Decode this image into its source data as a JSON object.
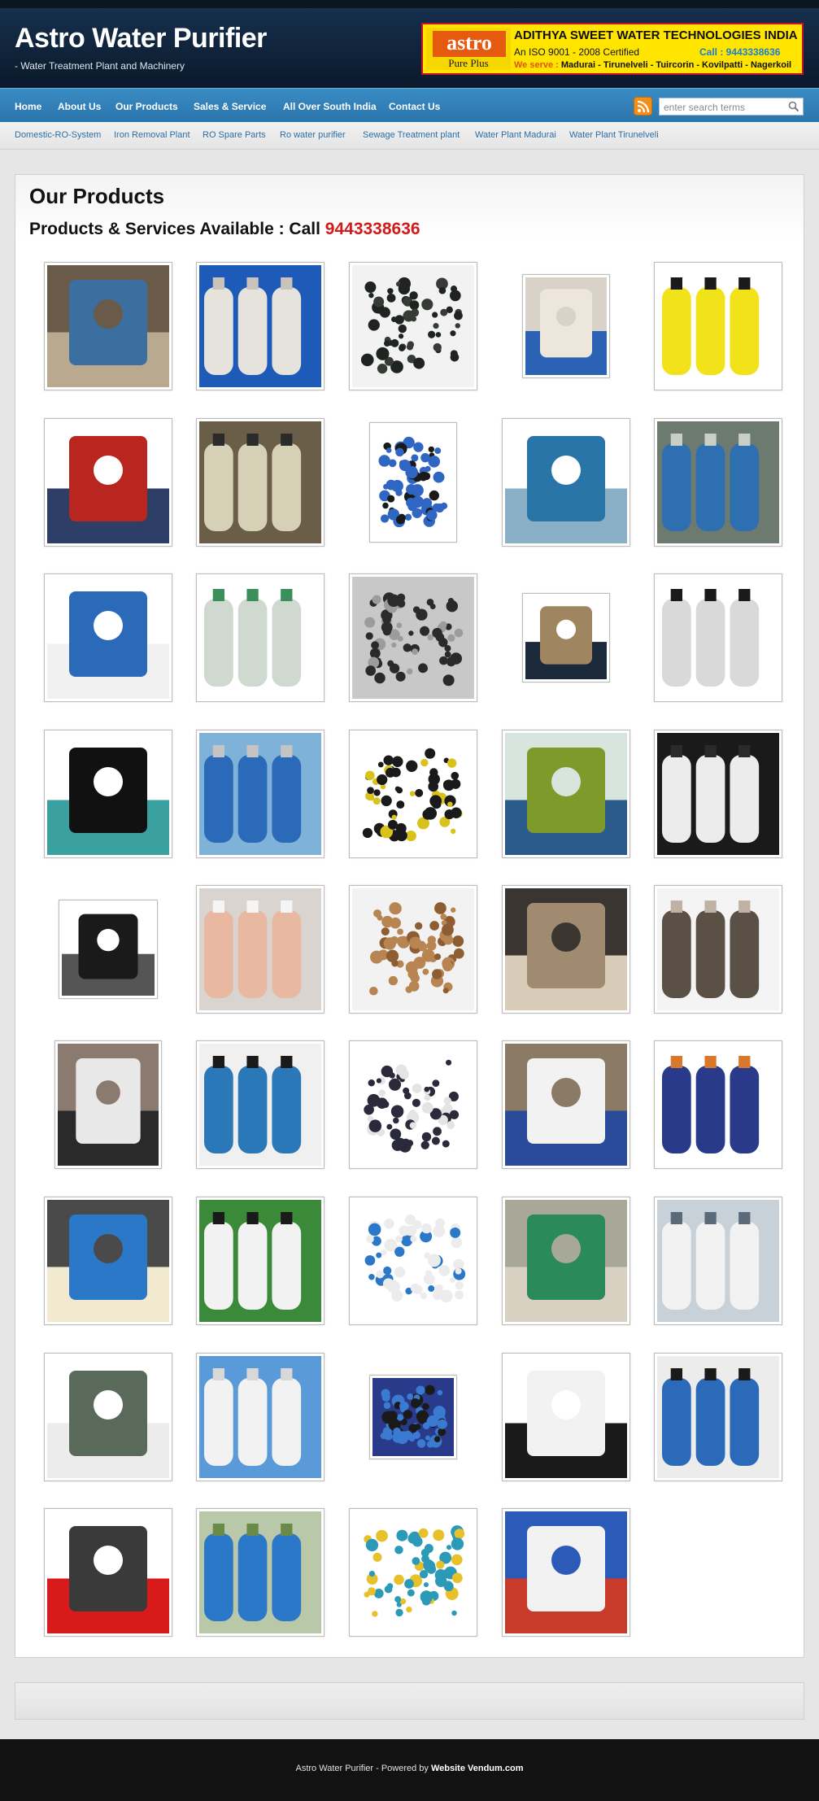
{
  "header": {
    "title": "Astro Water Purifier",
    "tagline": "- Water Treatment Plant and Machinery"
  },
  "banner": {
    "logo_word": "astro",
    "logo_sub": "Pure Plus",
    "company": "ADITHYA SWEET WATER TECHNOLOGIES INDIA",
    "iso": "An ISO 9001 - 2008 Certified",
    "call": "Call : 9443338636",
    "serve_lead": "We serve :",
    "serve_places": "Madurai - Tirunelveli - Tuircorin - Kovilpatti - Nagerkoil"
  },
  "nav": {
    "items": [
      {
        "label": "Home"
      },
      {
        "label": "About Us"
      },
      {
        "label": "Our Products"
      },
      {
        "label": "Sales & Service"
      },
      {
        "label": "All Over South India"
      },
      {
        "label": "Contact Us"
      }
    ],
    "search_placeholder": "enter search terms"
  },
  "subnav": {
    "items": [
      {
        "label": "Domestic-RO-System"
      },
      {
        "label": "Iron Removal Plant"
      },
      {
        "label": "RO Spare Parts"
      },
      {
        "label": "Ro water purifier"
      },
      {
        "label": "Sewage Treatment plant"
      },
      {
        "label": "Water Plant Madurai"
      },
      {
        "label": "Water Plant Tirunelveli"
      }
    ]
  },
  "main": {
    "title": "Our Products",
    "subtitle": "Products & Services Available : Call",
    "phone": "9443338636"
  },
  "products": [
    {
      "name": "ro-plant-image",
      "colors": [
        "#6a5a4a",
        "#3a6fa0",
        "#b9a98e"
      ]
    },
    {
      "name": "ceramic-filter-candles-image",
      "colors": [
        "#1e5bb8",
        "#e6e2dc",
        "#c9c3bb"
      ]
    },
    {
      "name": "activated-carbon-image",
      "colors": [
        "#f2f2f2",
        "#1f2420",
        "#363b36"
      ]
    },
    {
      "name": "string-wound-cartridges-image",
      "colors": [
        "#d8d2c8",
        "#ede6da",
        "#2c62b3"
      ]
    },
    {
      "name": "dosing-pump-yellow-image",
      "colors": [
        "#ffffff",
        "#f2e21a",
        "#1a1a1a"
      ]
    },
    {
      "name": "dosing-pump-red-image",
      "colors": [
        "#ffffff",
        "#b8261f",
        "#2d3f66"
      ]
    },
    {
      "name": "frp-vessel-plant-image",
      "colors": [
        "#6b5e48",
        "#d6d0b6",
        "#2a2a2a"
      ]
    },
    {
      "name": "filter-housings-image",
      "colors": [
        "#ffffff",
        "#2f66c4",
        "#1a1a1a"
      ]
    },
    {
      "name": "treatment-plant-blue-image",
      "colors": [
        "#ffffff",
        "#2a75a8",
        "#8ab0c8"
      ]
    },
    {
      "name": "frp-vessels-blue-image",
      "colors": [
        "#6c7a70",
        "#2d6fb1",
        "#c9cfc4"
      ]
    },
    {
      "name": "water-softener-image",
      "colors": [
        "#ffffff",
        "#2b6ab8",
        "#f1f1f1"
      ]
    },
    {
      "name": "rotameters-image",
      "colors": [
        "#ffffff",
        "#cfd9cf",
        "#3b8f5b"
      ]
    },
    {
      "name": "ro-system-frame-image",
      "colors": [
        "#c8c8c8",
        "#2a2a2a",
        "#9c9c9c"
      ]
    },
    {
      "name": "membrane-elements-image",
      "colors": [
        "#ffffff",
        "#a08660",
        "#1a2a3a"
      ]
    },
    {
      "name": "flow-meters-image",
      "colors": [
        "#ffffff",
        "#d9d9d9",
        "#1a1a1a"
      ]
    },
    {
      "name": "multiport-valve-black-image",
      "colors": [
        "#ffffff",
        "#111111",
        "#3aa0a0"
      ]
    },
    {
      "name": "pressure-filters-image",
      "colors": [
        "#7fb2d9",
        "#2b6ab8",
        "#c4c4c4"
      ]
    },
    {
      "name": "multiport-valve-top-image",
      "colors": [
        "#ffffff",
        "#1a1a1a",
        "#d9c21a"
      ]
    },
    {
      "name": "plant-room-green-image",
      "colors": [
        "#d8e4de",
        "#7e9a2a",
        "#2a5a8a"
      ]
    },
    {
      "name": "acetal-resin-bag-image",
      "colors": [
        "#1a1a1a",
        "#ececec",
        "#2a2a2a"
      ]
    },
    {
      "name": "manual-valve-image",
      "colors": [
        "#ffffff",
        "#1a1a1a",
        "#555555"
      ]
    },
    {
      "name": "salt-crystals-hands-image",
      "colors": [
        "#d9d4cf",
        "#e8b9a0",
        "#f5f5f5"
      ]
    },
    {
      "name": "filter-sand-image",
      "colors": [
        "#f2f2f2",
        "#b88552",
        "#8e5e32"
      ]
    },
    {
      "name": "pebbles-image",
      "colors": [
        "#3a3530",
        "#a08a70",
        "#d8cbb8"
      ]
    },
    {
      "name": "filter-gravel-image",
      "colors": [
        "#f4f4f4",
        "#5a5046",
        "#bfb2a2"
      ]
    },
    {
      "name": "stainless-housings-image",
      "colors": [
        "#8a7a70",
        "#e8e8e8",
        "#2a2a2a"
      ]
    },
    {
      "name": "dosing-pump-blue-image",
      "colors": [
        "#f0f0f0",
        "#2b78b8",
        "#1a1a1a"
      ]
    },
    {
      "name": "dosing-pump-white-image",
      "colors": [
        "#ffffff",
        "#2a2a3a",
        "#e4e4e4"
      ]
    },
    {
      "name": "chemical-sacks-image",
      "colors": [
        "#8a7a66",
        "#f2f2f2",
        "#2a4a9a"
      ]
    },
    {
      "name": "dosing-pump-navy-image",
      "colors": [
        "#ffffff",
        "#2a3a8a",
        "#d9782a"
      ]
    },
    {
      "name": "ro-membrane-image",
      "colors": [
        "#4a4a4a",
        "#2b78c8",
        "#f2ead0"
      ]
    },
    {
      "name": "sediment-cartridges-image",
      "colors": [
        "#3a8a3a",
        "#f2f2f2",
        "#1a1a1a"
      ]
    },
    {
      "name": "frp-vessels-white-image",
      "colors": [
        "#ffffff",
        "#ececec",
        "#2b78c8"
      ]
    },
    {
      "name": "outdoor-filters-green-image",
      "colors": [
        "#a8a898",
        "#2a8a5a",
        "#d8d0c0"
      ]
    },
    {
      "name": "rotameters-grey-image",
      "colors": [
        "#c8d0d8",
        "#f2f2f2",
        "#5a6a7a"
      ]
    },
    {
      "name": "carbon-cartridges-image",
      "colors": [
        "#ffffff",
        "#5a6a5a",
        "#ececec"
      ]
    },
    {
      "name": "domestic-ro-unit-image",
      "colors": [
        "#5a9ad8",
        "#f2f2f2",
        "#d8d8d8"
      ]
    },
    {
      "name": "filter-housing-small-image",
      "colors": [
        "#2a3a8a",
        "#3a7ad0",
        "#1a1a1a"
      ]
    },
    {
      "name": "resin-bag-image",
      "colors": [
        "#ffffff",
        "#f2f2f2",
        "#1a1a1a"
      ]
    },
    {
      "name": "jumbo-housings-image",
      "colors": [
        "#ececec",
        "#2b6ab8",
        "#1a1a1a"
      ]
    },
    {
      "name": "rotameters-red-image",
      "colors": [
        "#ffffff",
        "#3a3a3a",
        "#d81a1a"
      ]
    },
    {
      "name": "chemical-tanks-image",
      "colors": [
        "#b8c8a8",
        "#2b78c8",
        "#6a8a4a"
      ]
    },
    {
      "name": "glass-rotameters-image",
      "colors": [
        "#ffffff",
        "#2a9ab8",
        "#e8c02a"
      ]
    },
    {
      "name": "pleated-cartridges-image",
      "colors": [
        "#2b5ab8",
        "#f2f2f2",
        "#c83a2a"
      ]
    }
  ],
  "footer": {
    "text": "Astro Water Purifier - Powered by",
    "link": "Website Vendum.com"
  }
}
